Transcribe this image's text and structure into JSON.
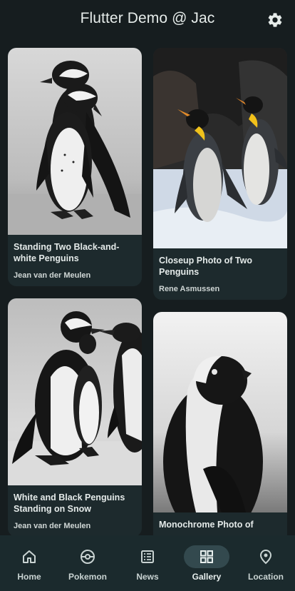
{
  "appbar": {
    "title": "Flutter Demo @ Jac",
    "settings_icon": "gear-icon"
  },
  "gallery": {
    "cards": [
      {
        "title": "Standing Two Black-and-white Penguins",
        "author": "Jean van der Meulen"
      },
      {
        "title": "Closeup Photo of Two Penguins",
        "author": "Rene Asmussen"
      },
      {
        "title": "White and Black Penguins Standing on Snow",
        "author": "Jean van der Meulen"
      },
      {
        "title": "Monochrome Photo of",
        "author": ""
      }
    ]
  },
  "navbar": {
    "selected": "Gallery",
    "items": [
      {
        "label": "Home",
        "icon": "home-icon"
      },
      {
        "label": "Pokemon",
        "icon": "pokeball-icon"
      },
      {
        "label": "News",
        "icon": "news-icon"
      },
      {
        "label": "Gallery",
        "icon": "grid-icon"
      },
      {
        "label": "Location",
        "icon": "location-pin-icon"
      }
    ]
  },
  "colors": {
    "background": "#161d1f",
    "card": "#1d2a2d",
    "navbar": "#1b2a2d",
    "active_pill": "#33494e"
  }
}
